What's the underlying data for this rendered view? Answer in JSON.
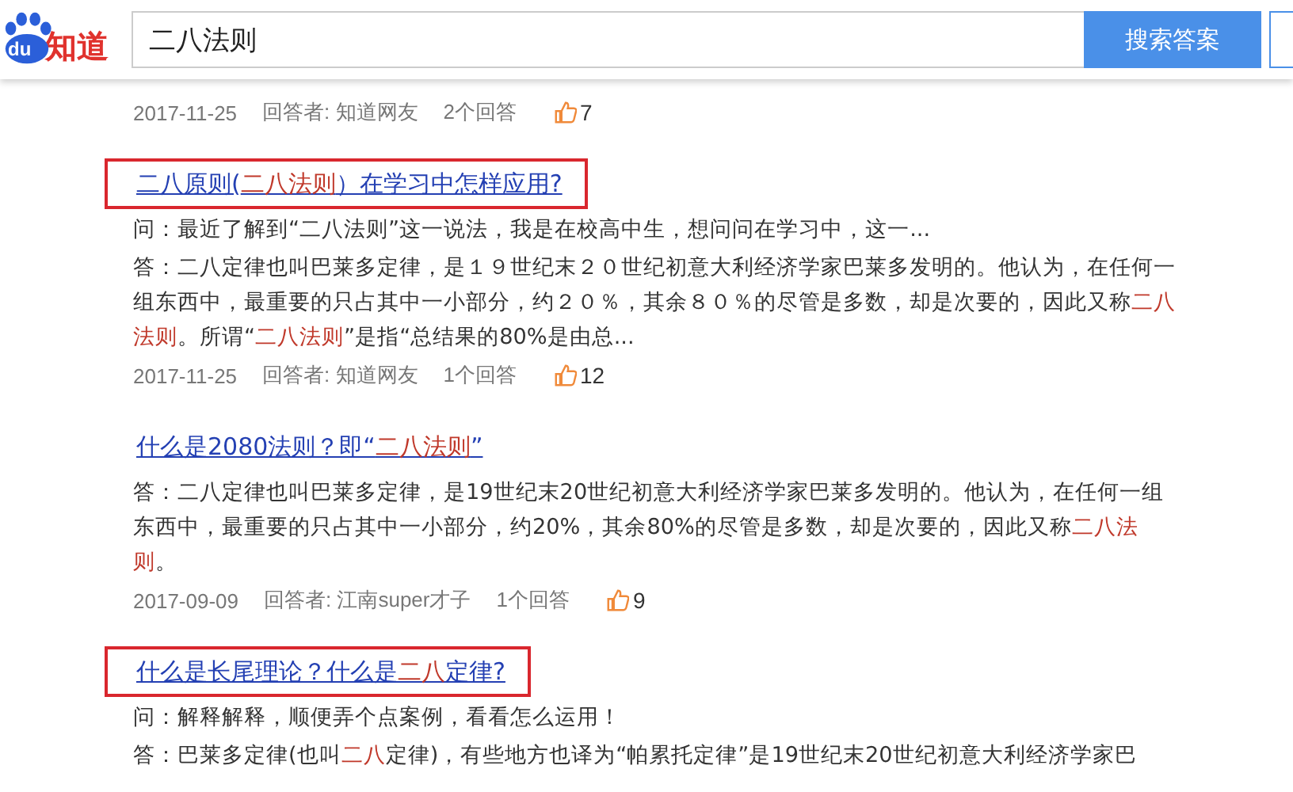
{
  "header": {
    "logo_badge": "du",
    "logo_text": "知道",
    "query": "二八法则",
    "search_button": "搜索答案"
  },
  "top_meta": {
    "date": "2017-11-25",
    "answerer": "回答者: 知道网友",
    "count": "2个回答",
    "likes": "7"
  },
  "results": [
    {
      "boxed": true,
      "title": [
        {
          "text": "二八原则(",
          "hl": false
        },
        {
          "text": "二八法则",
          "hl": true
        },
        {
          "text": "）在学习中怎样应用?",
          "hl": false
        }
      ],
      "question": "问：最近了解到“二八法则”这一说法，我是在校高中生，想问问在学习中，这一...",
      "answer": [
        {
          "text": "答：二八定律也叫巴莱多定律，是１９世纪末２０世纪初意大利经济学家巴莱多发明的。他认为，在任何一组东西中，最重要的只占其中一小部分，约２０％，其余８０％的尽管是多数，却是次要的，因此又称",
          "hl": false
        },
        {
          "text": "二八法则",
          "hl": true
        },
        {
          "text": "。所谓“",
          "hl": false
        },
        {
          "text": "二八法则",
          "hl": true
        },
        {
          "text": "”是指“总结果的80%是由总...",
          "hl": false
        }
      ],
      "meta": {
        "date": "2017-11-25",
        "answerer": "回答者: 知道网友",
        "count": "1个回答",
        "likes": "12"
      }
    },
    {
      "boxed": false,
      "title": [
        {
          "text": "什么是2080法则？即“",
          "hl": false
        },
        {
          "text": "二八法则",
          "hl": true
        },
        {
          "text": "”",
          "hl": false
        }
      ],
      "answer": [
        {
          "text": "答：二八定律也叫巴莱多定律，是19世纪末20世纪初意大利经济学家巴莱多发明的。他认为，在任何一组东西中，最重要的只占其中一小部分，约20%，其余80%的尽管是多数，却是次要的，因此又称",
          "hl": false
        },
        {
          "text": "二八法则",
          "hl": true
        },
        {
          "text": "。",
          "hl": false
        }
      ],
      "meta": {
        "date": "2017-09-09",
        "answerer": "回答者: 江南super才子",
        "count": "1个回答",
        "likes": "9"
      }
    },
    {
      "boxed": true,
      "title": [
        {
          "text": "什么是长尾理论？什么是",
          "hl": false
        },
        {
          "text": "二八",
          "hl": true
        },
        {
          "text": "定律?",
          "hl": false
        }
      ],
      "question": "问：解释解释，顺便弄个点案例，看看怎么运用！",
      "answer": [
        {
          "text": "答：巴莱多定律(也叫",
          "hl": false
        },
        {
          "text": "二八",
          "hl": true
        },
        {
          "text": "定律)，有些地方也译为“帕累托定律”是19世纪末20世纪初意大利经济学家巴",
          "hl": false
        }
      ]
    }
  ]
}
